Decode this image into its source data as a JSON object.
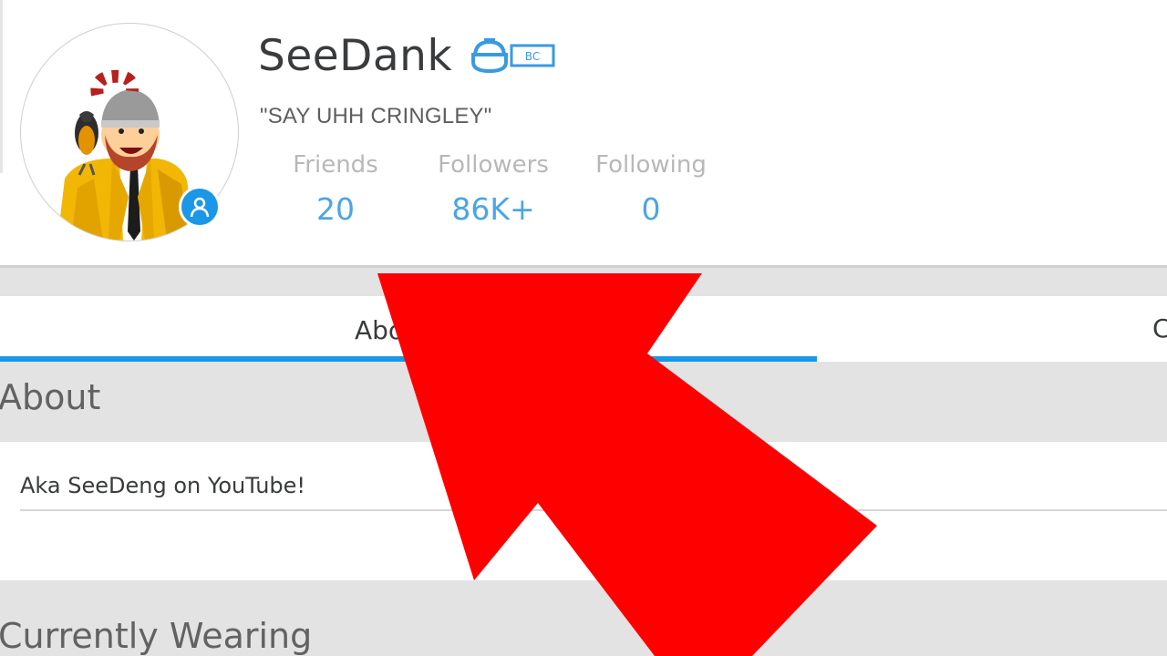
{
  "profile": {
    "username": "SeeDank",
    "status": "\"SAY UHH CRINGLEY\"",
    "membership_badge": "BC",
    "stats": [
      {
        "label": "Friends",
        "value": "20"
      },
      {
        "label": "Followers",
        "value": "86K+"
      },
      {
        "label": "Following",
        "value": "0"
      }
    ]
  },
  "tabs": {
    "about_label": "About",
    "creations_label": "C"
  },
  "about": {
    "heading": "About",
    "description": "Aka SeeDeng on YouTube!"
  },
  "wearing": {
    "heading": "Currently Wearing"
  },
  "colors": {
    "accent_blue": "#1a97e6",
    "stat_blue": "#4ca5e6",
    "arrow_red": "#ff0000",
    "panel_gray": "#e3e3e3"
  },
  "icons": [
    "user-presence-icon",
    "builders-club-icon",
    "red-arrow-overlay"
  ]
}
